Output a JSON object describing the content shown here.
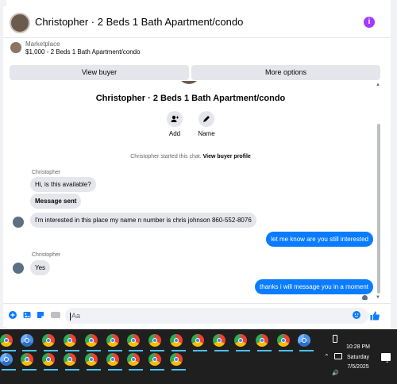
{
  "header": {
    "title": "Christopher · 2 Beds 1 Bath Apartment/condo",
    "info_icon": "info-icon",
    "info_symbol": "i"
  },
  "marketplace": {
    "label": "Marketplace",
    "listing": "$1,000 - 2 Beds 1 Bath Apartment/condo"
  },
  "buttons": {
    "view_buyer": "View buyer",
    "more_options": "More options"
  },
  "profile": {
    "title": "Christopher · 2 Beds 1 Bath Apartment/condo",
    "actions": [
      {
        "label": "Add",
        "icon": "add-person-icon"
      },
      {
        "label": "Name",
        "icon": "pencil-icon"
      }
    ]
  },
  "system": {
    "started": "Christopher started this chat.",
    "profile_link": "View buyer profile"
  },
  "messages": [
    {
      "sender": "Christopher",
      "text": "Hi, is this available?",
      "direction": "in"
    },
    {
      "text": "Message sent",
      "direction": "in"
    },
    {
      "text": "I'm interested in this place my name n number is chris johnson 860-552-8076",
      "direction": "in"
    },
    {
      "text": "let me know are you still interested",
      "direction": "out"
    },
    {
      "sender": "Christopher",
      "text": "Yes",
      "direction": "in"
    },
    {
      "text": "thanks i will message you in a moment",
      "direction": "out"
    }
  ],
  "composer": {
    "placeholder": "Aa",
    "icons": [
      "plus-icon",
      "photo-icon",
      "sticker-icon",
      "gif-icon",
      "emoji-icon",
      "like-icon"
    ]
  },
  "taskbar": {
    "time": "10:28 PM",
    "day": "Saturday",
    "date": "7/5/2025"
  },
  "colors": {
    "accent": "#0a7cff",
    "info": "#a23bff",
    "bubble_in": "#e4e6eb",
    "taskbar": "#1f1f1f"
  }
}
